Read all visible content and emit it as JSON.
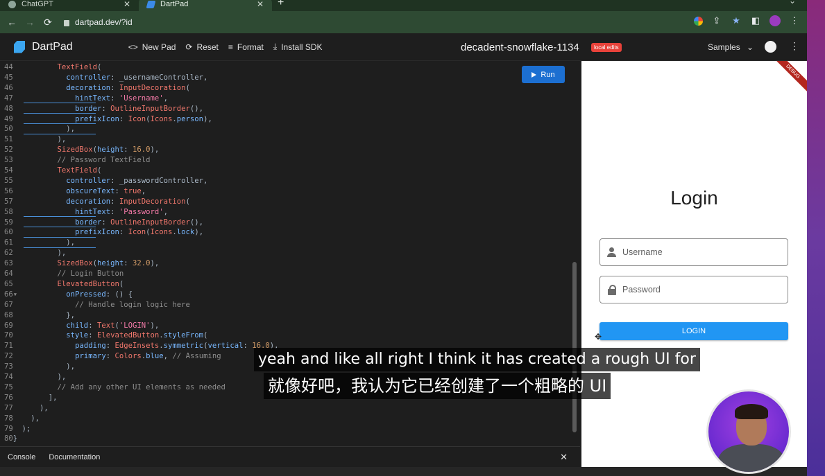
{
  "browser": {
    "tabs": [
      {
        "title": "ChatGPT"
      },
      {
        "title": "DartPad",
        "active": true
      }
    ],
    "new_tab": "+",
    "url": "dartpad.dev/?id"
  },
  "dartpad": {
    "title": "DartPad",
    "actions": [
      {
        "icon": "code-icon",
        "glyph": "<>",
        "label": "New Pad"
      },
      {
        "icon": "refresh-icon",
        "glyph": "⟳",
        "label": "Reset"
      },
      {
        "icon": "format-icon",
        "glyph": "≡",
        "label": "Format"
      },
      {
        "icon": "download-icon",
        "glyph": "⤓",
        "label": "Install SDK"
      }
    ],
    "pad_name": "decadent-snowflake-1134",
    "badge": "local edits",
    "samples_label": "Samples",
    "run_label": "Run"
  },
  "code_lines": [
    {
      "n": "44",
      "h": "            <span class='k'>TextField</span>("
    },
    {
      "n": "45",
      "h": "              <span class='p'>controller</span>: _usernameController,"
    },
    {
      "n": "46",
      "h": "              <span class='p'>decoration</span>: <span class='k'>InputDecoration</span>("
    },
    {
      "n": "47",
      "h": "                <span class='p'>hintText</span>: <span class='s'>'Username'</span>,"
    },
    {
      "n": "48",
      "h": "                <span class='p'>border</span>: <span class='k'>OutlineInputBorder</span>(),"
    },
    {
      "n": "49",
      "h": "                <span class='p'>prefixIcon</span>: <span class='k'>Icon</span>(<span class='k'>Icons</span>.<span class='p'>person</span>),"
    },
    {
      "n": "50",
      "h": "              ),"
    },
    {
      "n": "51",
      "h": "            ),"
    },
    {
      "n": "52",
      "h": "            <span class='k'>SizedBox</span>(<span class='p'>height</span>: <span class='n'>16.0</span>),"
    },
    {
      "n": "53",
      "h": "            <span class='c'>// Password TextField</span>"
    },
    {
      "n": "54",
      "h": "            <span class='k'>TextField</span>("
    },
    {
      "n": "55",
      "h": "              <span class='p'>controller</span>: _passwordController,"
    },
    {
      "n": "56",
      "h": "              <span class='p'>obscureText</span>: <span class='k'>true</span>,"
    },
    {
      "n": "57",
      "h": "              <span class='p'>decoration</span>: <span class='k'>InputDecoration</span>("
    },
    {
      "n": "58",
      "h": "                <span class='p'>hintText</span>: <span class='s'>'Password'</span>,"
    },
    {
      "n": "59",
      "h": "                <span class='p'>border</span>: <span class='k'>OutlineInputBorder</span>(),"
    },
    {
      "n": "60",
      "h": "                <span class='p'>prefixIcon</span>: <span class='k'>Icon</span>(<span class='k'>Icons</span>.<span class='p'>lock</span>),"
    },
    {
      "n": "61",
      "h": "              ),"
    },
    {
      "n": "62",
      "h": "            ),"
    },
    {
      "n": "63",
      "h": "            <span class='k'>SizedBox</span>(<span class='p'>height</span>: <span class='n'>32.0</span>),"
    },
    {
      "n": "64",
      "h": "            <span class='c'>// Login Button</span>"
    },
    {
      "n": "65",
      "h": "            <span class='k'>ElevatedButton</span>("
    },
    {
      "n": "66",
      "h": "              <span class='p'>onPressed</span>: () {"
    },
    {
      "n": "67",
      "h": "                <span class='c'>// Handle login logic here</span>"
    },
    {
      "n": "68",
      "h": "              },"
    },
    {
      "n": "69",
      "h": "              <span class='p'>child</span>: <span class='k'>Text</span>(<span class='s'>'LOGIN'</span>),"
    },
    {
      "n": "70",
      "h": "              <span class='p'>style</span>: <span class='k'>ElevatedButton</span>.<span class='p'>styleFrom</span>("
    },
    {
      "n": "71",
      "h": "                <span class='p'>padding</span>: <span class='k'>EdgeInsets</span>.<span class='p'>symmetric</span>(<span class='p'>vertical</span>: <span class='n'>16.0</span>),"
    },
    {
      "n": "72",
      "h": "                <span class='p'>primary</span>: <span class='k'>Colors</span>.<span class='p'>blue</span>, <span class='c'>// Assuming</span>"
    },
    {
      "n": "73",
      "h": "              ),"
    },
    {
      "n": "74",
      "h": "            ),"
    },
    {
      "n": "75",
      "h": "            <span class='c'>// Add any other UI elements as needed</span>"
    },
    {
      "n": "76",
      "h": "          ],"
    },
    {
      "n": "77",
      "h": "        ),"
    },
    {
      "n": "78",
      "h": "      ),"
    },
    {
      "n": "79",
      "h": "    );"
    },
    {
      "n": "80",
      "h": "  }"
    }
  ],
  "console": {
    "tabs": [
      "Console",
      "Documentation"
    ],
    "close": "✕"
  },
  "preview": {
    "debug_banner": "DEBUG",
    "title": "Login",
    "username_hint": "Username",
    "password_hint": "Password",
    "button_label": "LOGIN"
  },
  "subtitles": {
    "en": "yeah and like all right I think it has created a rough UI for",
    "zh": "就像好吧，我认为它已经创建了一个粗略的 UI"
  },
  "colors": {
    "run_button": "#1c6fd1",
    "login_button": "#2196f3",
    "badge": "#e8423a"
  }
}
